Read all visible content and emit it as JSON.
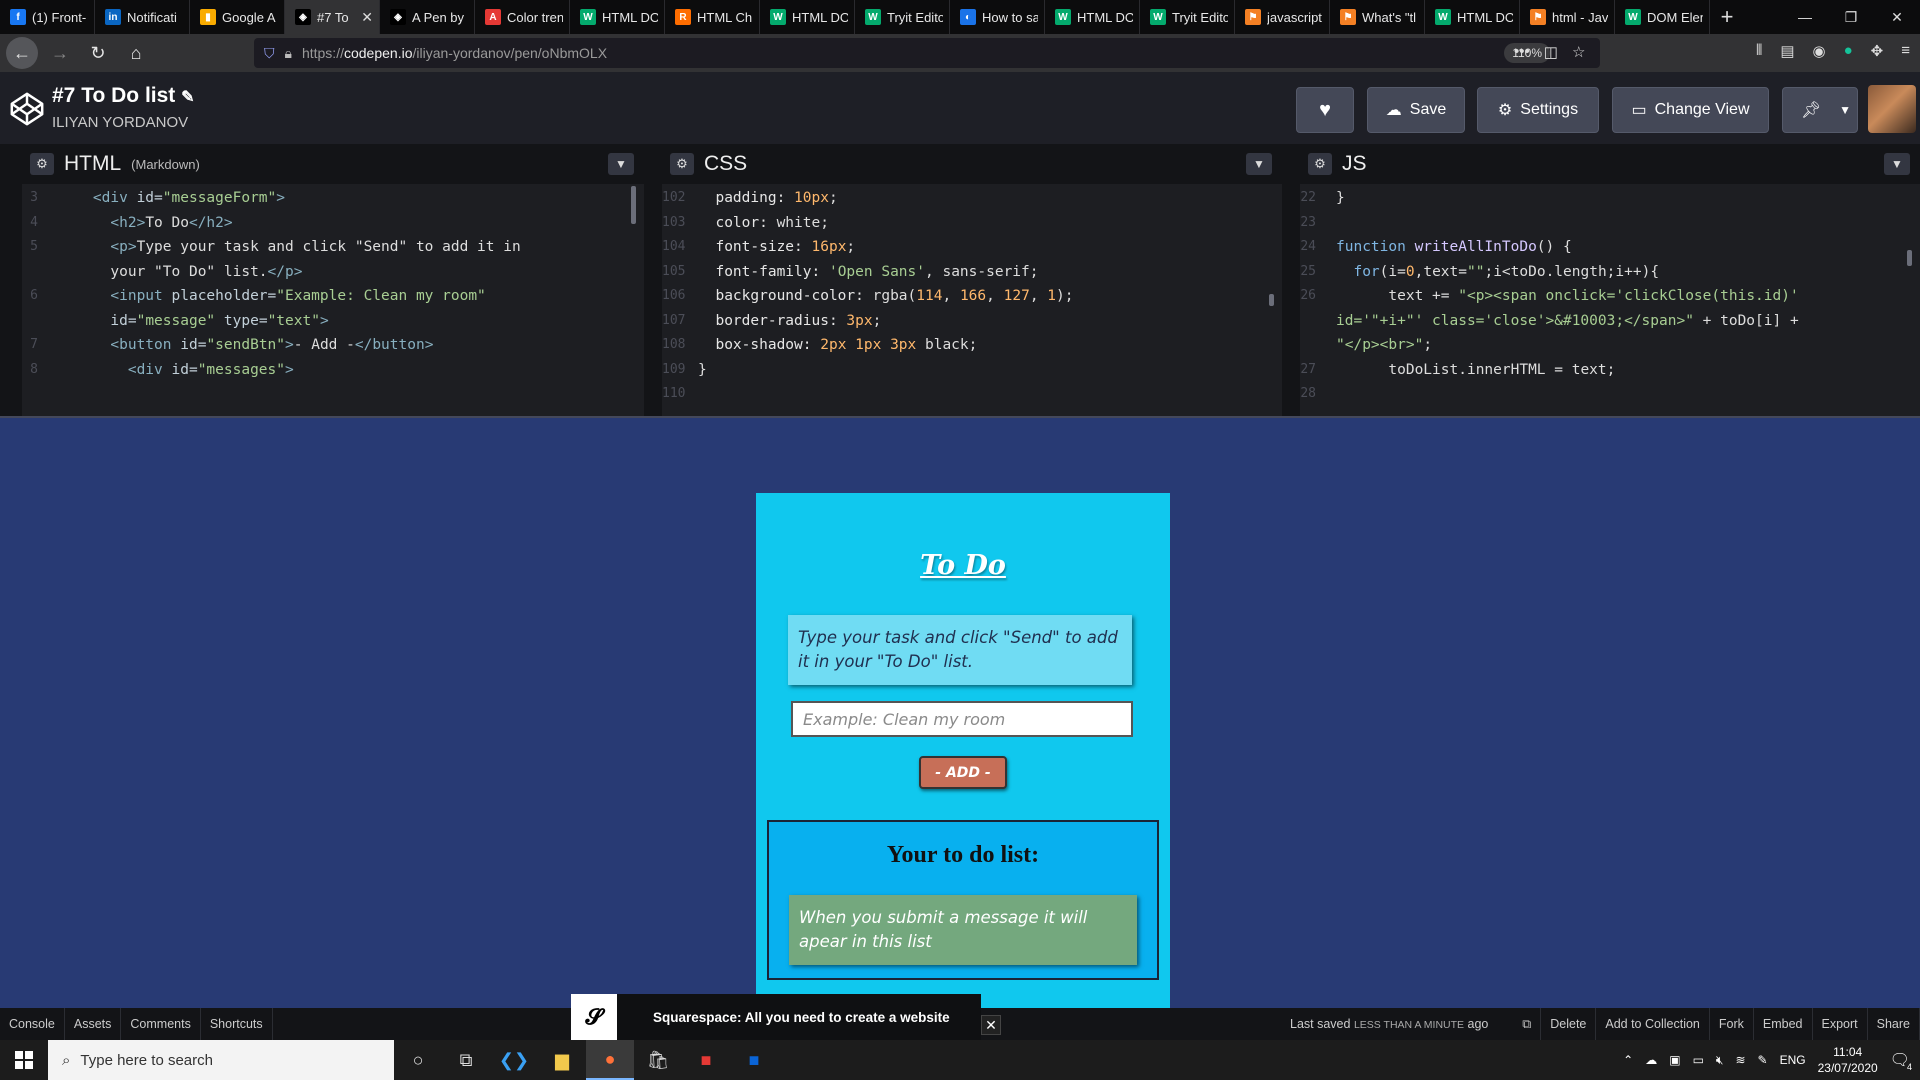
{
  "browser": {
    "tabs": [
      {
        "label": "(1) Front-",
        "fav": "f",
        "color": "#1877f2"
      },
      {
        "label": "Notificati",
        "fav": "in",
        "color": "#0a66c2"
      },
      {
        "label": "Google A",
        "fav": "▮",
        "color": "#f9ab00"
      },
      {
        "label": "#7 To",
        "fav": "◈",
        "color": "#000000",
        "active": true
      },
      {
        "label": "A Pen by",
        "fav": "◈",
        "color": "#000000"
      },
      {
        "label": "Color tren",
        "fav": "A",
        "color": "#e53935"
      },
      {
        "label": "HTML DO",
        "fav": "W",
        "color": "#04aa6d"
      },
      {
        "label": "HTML Ch",
        "fav": "R",
        "color": "#ff6d00"
      },
      {
        "label": "HTML DO",
        "fav": "W",
        "color": "#04aa6d"
      },
      {
        "label": "Tryit Edito",
        "fav": "W",
        "color": "#04aa6d"
      },
      {
        "label": "How to sa",
        "fav": "◐",
        "color": "#1a73e8"
      },
      {
        "label": "HTML DO",
        "fav": "W",
        "color": "#04aa6d"
      },
      {
        "label": "Tryit Edito",
        "fav": "W",
        "color": "#04aa6d"
      },
      {
        "label": "javascript",
        "fav": "⚑",
        "color": "#f48024"
      },
      {
        "label": "What's \"tl",
        "fav": "⚑",
        "color": "#f48024"
      },
      {
        "label": "HTML DO",
        "fav": "W",
        "color": "#04aa6d"
      },
      {
        "label": "html - Jav",
        "fav": "⚑",
        "color": "#f48024"
      },
      {
        "label": "DOM Elen",
        "fav": "W",
        "color": "#04aa6d"
      }
    ],
    "url_prefix": "https://",
    "url_host": "codepen.io",
    "url_path": "/iliyan-yordanov/pen/oNbmOLX",
    "zoom": "110%"
  },
  "header": {
    "title": "#7 To Do list",
    "author": "ILIYAN YORDANOV",
    "save_label": "Save",
    "settings_label": "Settings",
    "change_view_label": "Change View"
  },
  "editors": {
    "html": {
      "name": "HTML",
      "sub": "(Markdown)",
      "lines": [
        {
          "n": "3",
          "parts": [
            [
              "",
              "    "
            ],
            [
              "tag",
              "<div "
            ],
            [
              "attr",
              "id="
            ],
            [
              "str",
              "\"messageForm\""
            ],
            [
              "tag",
              ">"
            ]
          ]
        },
        {
          "n": "4",
          "parts": [
            [
              "",
              "      "
            ],
            [
              "tag",
              "<h2>"
            ],
            [
              "",
              "To Do"
            ],
            [
              "tag",
              "</h2>"
            ]
          ]
        },
        {
          "n": "5",
          "parts": [
            [
              "",
              "      "
            ],
            [
              "tag",
              "<p>"
            ],
            [
              "",
              "Type your task and click \"Send\" to add it in\n      your \"To Do\" list."
            ],
            [
              "tag",
              "</p>"
            ]
          ]
        },
        {
          "n": "6",
          "parts": [
            [
              "",
              "      "
            ],
            [
              "tag",
              "<input "
            ],
            [
              "attr",
              "placeholder="
            ],
            [
              "str",
              "\"Example: Clean my room\""
            ],
            [
              "",
              "\n      "
            ],
            [
              "attr",
              "id="
            ],
            [
              "str",
              "\"message\" "
            ],
            [
              "attr",
              "type="
            ],
            [
              "str",
              "\"text\""
            ],
            [
              "tag",
              ">"
            ]
          ]
        },
        {
          "n": "7",
          "parts": [
            [
              "",
              "      "
            ],
            [
              "tag",
              "<button "
            ],
            [
              "attr",
              "id="
            ],
            [
              "str",
              "\"sendBtn\""
            ],
            [
              "tag",
              ">"
            ],
            [
              "",
              "- Add -"
            ],
            [
              "tag",
              "</button>"
            ]
          ]
        },
        {
          "n": "8",
          "parts": [
            [
              "",
              "        "
            ],
            [
              "tag",
              "<div "
            ],
            [
              "attr",
              "id="
            ],
            [
              "str",
              "\"messages\""
            ],
            [
              "tag",
              ">"
            ]
          ]
        }
      ]
    },
    "css": {
      "name": "CSS",
      "lines": [
        {
          "n": "102",
          "parts": [
            [
              "prop",
              "  padding: "
            ],
            [
              "val",
              "10px"
            ],
            [
              "",
              ";"
            ]
          ]
        },
        {
          "n": "103",
          "parts": [
            [
              "prop",
              "  color: "
            ],
            [
              "",
              "white;"
            ]
          ]
        },
        {
          "n": "104",
          "parts": [
            [
              "prop",
              "  font-size: "
            ],
            [
              "val",
              "16px"
            ],
            [
              "",
              ";"
            ]
          ]
        },
        {
          "n": "105",
          "parts": [
            [
              "prop",
              "  font-family: "
            ],
            [
              "str",
              "'Open Sans'"
            ],
            [
              "",
              ", sans-serif;"
            ]
          ]
        },
        {
          "n": "106",
          "parts": [
            [
              "prop",
              "  background-color: "
            ],
            [
              "",
              "rgba("
            ],
            [
              "val",
              "114"
            ],
            [
              "",
              ", "
            ],
            [
              "val",
              "166"
            ],
            [
              "",
              ", "
            ],
            [
              "val",
              "127"
            ],
            [
              "",
              ", "
            ],
            [
              "val",
              "1"
            ],
            [
              "",
              ");"
            ]
          ]
        },
        {
          "n": "107",
          "parts": [
            [
              "prop",
              "  border-radius: "
            ],
            [
              "val",
              "3px"
            ],
            [
              "",
              ";"
            ]
          ]
        },
        {
          "n": "108",
          "parts": [
            [
              "prop",
              "  box-shadow: "
            ],
            [
              "val",
              "2px 1px 3px"
            ],
            [
              "",
              " black;"
            ]
          ]
        },
        {
          "n": "109",
          "parts": [
            [
              "",
              "}"
            ]
          ]
        },
        {
          "n": "110",
          "parts": [
            [
              "",
              ""
            ]
          ]
        }
      ]
    },
    "js": {
      "name": "JS",
      "lines": [
        {
          "n": "22",
          "parts": [
            [
              "",
              "}"
            ]
          ]
        },
        {
          "n": "23",
          "parts": [
            [
              "",
              ""
            ]
          ]
        },
        {
          "n": "24",
          "parts": [
            [
              "kw",
              "function "
            ],
            [
              "fn",
              "writeAllInToDo"
            ],
            [
              "",
              "() {"
            ]
          ]
        },
        {
          "n": "25",
          "parts": [
            [
              "",
              "  "
            ],
            [
              "kw",
              "for"
            ],
            [
              "",
              "(i="
            ],
            [
              "val",
              "0"
            ],
            [
              "",
              ",text="
            ],
            [
              "str",
              "\"\""
            ],
            [
              "",
              ";i<toDo.length;i++){"
            ]
          ]
        },
        {
          "n": "26",
          "parts": [
            [
              "",
              "      text += "
            ],
            [
              "str",
              "\"<p><span onclick='clickClose(this.id)'\nid='\"+i+\"' class='close'>&#10003;</span>\""
            ],
            [
              "",
              " + toDo[i] +\n"
            ],
            [
              "str",
              "\"</p><br>\""
            ],
            [
              "",
              ";"
            ]
          ]
        },
        {
          "n": "27",
          "parts": [
            [
              "",
              "      toDoList.innerHTML = text;"
            ]
          ]
        },
        {
          "n": "28",
          "parts": [
            [
              "",
              ""
            ]
          ]
        }
      ]
    }
  },
  "preview": {
    "title": "To Do",
    "description": "Type your task and click \"Send\" to add it in your \"To Do\" list.",
    "input_placeholder": "Example: Clean my room",
    "add_button": "- ADD -",
    "list_title": "Your to do list:",
    "list_item": "When you submit a message it will apear in this list"
  },
  "footer": {
    "console": "Console",
    "assets": "Assets",
    "comments": "Comments",
    "shortcuts": "Shortcuts",
    "ad_text": "Squarespace: All you need to create a website",
    "saved_prefix": "Last saved",
    "saved_small": "LESS THAN A MINUTE",
    "saved_suffix": "ago",
    "delete": "Delete",
    "add_to_collection": "Add to Collection",
    "fork": "Fork",
    "embed": "Embed",
    "export": "Export",
    "share": "Share"
  },
  "taskbar": {
    "search_placeholder": "Type here to search",
    "language": "ENG",
    "time": "11:04",
    "date": "23/07/2020",
    "notifications": "4"
  }
}
